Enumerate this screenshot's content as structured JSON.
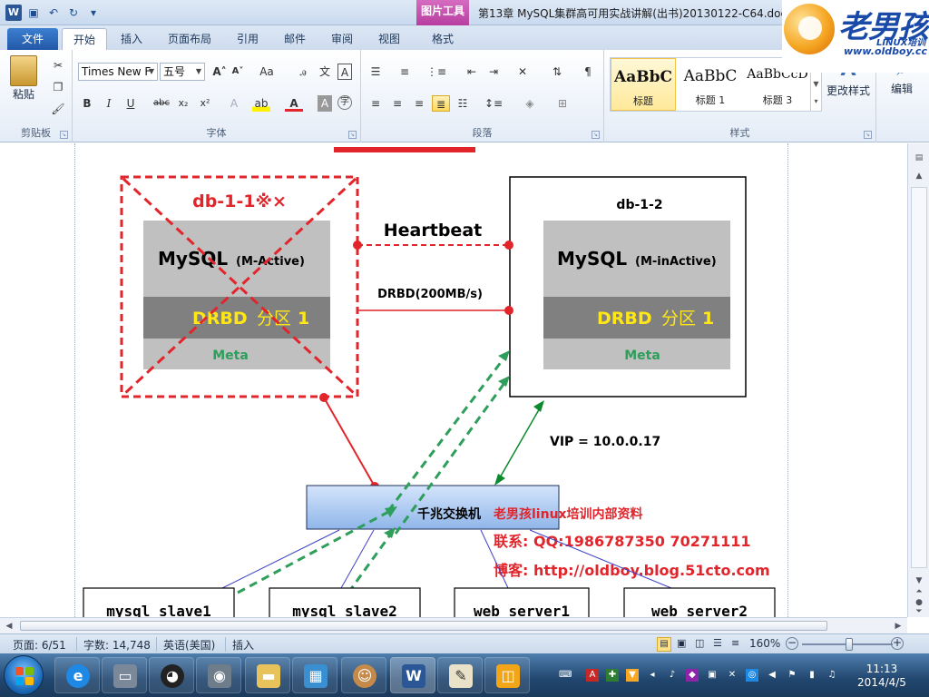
{
  "window": {
    "title": "第13章 MySQL集群高可用实战讲解(出书)20130122-C64.doc",
    "context_tab": "图片工具"
  },
  "brand": {
    "name": "老男孩",
    "sub": "LINUX培训",
    "url": "www.oldboy.cc"
  },
  "ribbon_tabs": [
    "文件",
    "开始",
    "插入",
    "页面布局",
    "引用",
    "邮件",
    "审阅",
    "视图",
    "格式"
  ],
  "ribbon": {
    "clipboard": {
      "label": "剪贴板",
      "paste": "粘贴"
    },
    "font": {
      "label": "字体",
      "font_name": "Times New F",
      "font_size": "五号"
    },
    "paragraph": {
      "label": "段落"
    },
    "styles": {
      "label": "样式",
      "items": [
        {
          "sample": "AaBbC",
          "name": "标题"
        },
        {
          "sample": "AaBbC",
          "name": "标题 1"
        },
        {
          "sample": "AaBbCcD",
          "name": "标题 3"
        }
      ],
      "change_styles": "更改样式"
    },
    "editing": {
      "label": "编辑"
    }
  },
  "diagram": {
    "db1_label": "db-1-1※×",
    "db2_label": "db-1-2",
    "mysql": "MySQL",
    "active": "(M-Active)",
    "inactive": "(M-inActive)",
    "drbd": "DRBD",
    "partition": "分区",
    "partition_num": "1",
    "meta": "Meta",
    "heartbeat": "Heartbeat",
    "drbd_link": "DRBD(200MB/s)",
    "vip": "VIP = 10.0.0.17",
    "switch": "千兆交换机",
    "notice": "老男孩linux培训内部资料",
    "contact": "联系: QQ:1986787350 70271111",
    "blog": "博客: http://oldboy.blog.51cto.com",
    "servers": [
      "mysql slave1",
      "mysql slave2",
      "web server1",
      "web server2"
    ]
  },
  "status": {
    "page": "页面: 6/51",
    "words": "字数: 14,748",
    "language": "英语(美国)",
    "mode": "插入",
    "zoom": "160%"
  },
  "taskbar": {
    "time": "11:13",
    "date": "2014/4/5"
  },
  "colors": {
    "red": "#e2242b",
    "green": "#2e9e5b",
    "yellow": "#ffe617",
    "blue_box": "#8fb6e9"
  }
}
